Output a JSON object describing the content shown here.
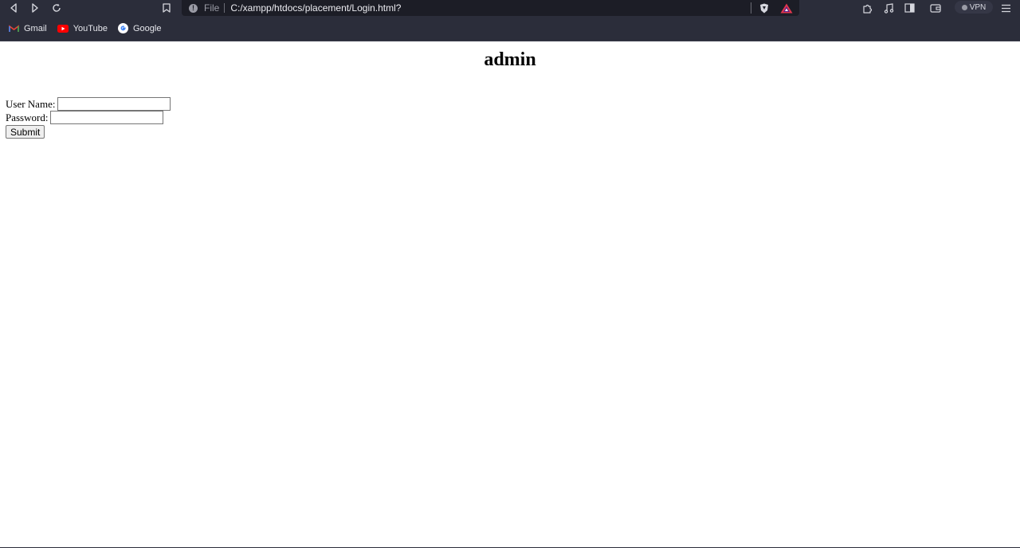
{
  "browser": {
    "address_bar": {
      "scheme_label": "File",
      "url": "C:/xampp/htdocs/placement/Login.html?"
    },
    "vpn_label": "VPN",
    "icons": [
      "back-icon",
      "forward-icon",
      "reload-icon",
      "bookmark-icon",
      "info-icon",
      "brave-shield-icon",
      "brave-rewards-icon",
      "extensions-icon",
      "media-icon",
      "sidebar-icon",
      "wallet-icon",
      "menu-icon"
    ]
  },
  "bookmarks": [
    {
      "label": "Gmail",
      "icon": "gmail-icon"
    },
    {
      "label": "YouTube",
      "icon": "youtube-icon"
    },
    {
      "label": "Google",
      "icon": "google-icon"
    }
  ],
  "page": {
    "heading": "admin",
    "form": {
      "username_label": "User Name:",
      "username_value": "",
      "password_label": "Password:",
      "password_value": "",
      "submit_label": "Submit"
    }
  }
}
